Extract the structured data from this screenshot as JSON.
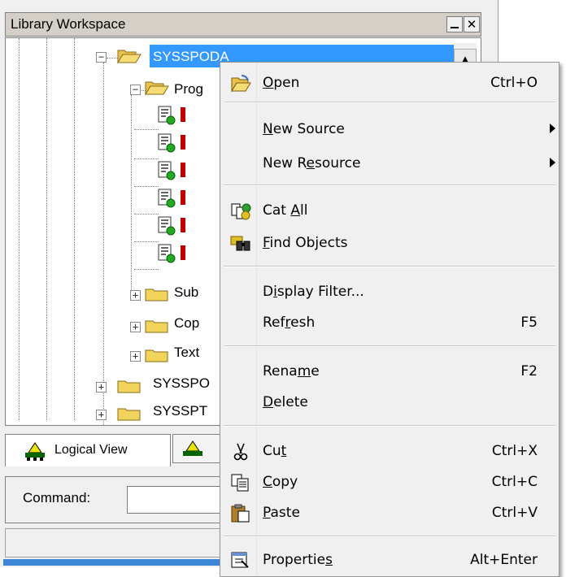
{
  "window": {
    "title": "Library Workspace"
  },
  "tree": {
    "selected_label": "SYSSPODA",
    "child_folder_label": "Prog",
    "subfolders": [
      "Sub",
      "Cop",
      "Text"
    ],
    "siblings": [
      "SYSSPO",
      "SYSSPT"
    ]
  },
  "tabs": {
    "logical_view": "Logical View"
  },
  "command": {
    "label": "Command:",
    "value": ""
  },
  "menu": {
    "open": {
      "label": "Open",
      "mnemonic_index": 0,
      "shortcut": "Ctrl+O",
      "icon": "open-folder-icon"
    },
    "new_source": {
      "label": "New Source",
      "mnemonic_index": 0,
      "has_submenu": true
    },
    "new_resource": {
      "label": "New Resource",
      "mnemonic_index": 5,
      "has_submenu": true
    },
    "cat_all": {
      "label": "Cat All",
      "mnemonic_index": 4,
      "icon": "cat-all-icon"
    },
    "find_objects": {
      "label": "Find Objects",
      "mnemonic_index": 0,
      "icon": "binoculars-icon"
    },
    "display_filter": {
      "label": "Display Filter...",
      "mnemonic_index": 1
    },
    "refresh": {
      "label": "Refresh",
      "mnemonic_index": 3,
      "shortcut": "F5"
    },
    "rename": {
      "label": "Rename",
      "mnemonic_index": 4,
      "shortcut": "F2"
    },
    "delete": {
      "label": "Delete",
      "mnemonic_index": 0
    },
    "cut": {
      "label": "Cut",
      "mnemonic_index": 2,
      "shortcut": "Ctrl+X",
      "icon": "scissors-icon"
    },
    "copy": {
      "label": "Copy",
      "mnemonic_index": 0,
      "shortcut": "Ctrl+C",
      "icon": "copy-icon"
    },
    "paste": {
      "label": "Paste",
      "mnemonic_index": 0,
      "shortcut": "Ctrl+V",
      "icon": "paste-icon"
    },
    "properties": {
      "label": "Properties",
      "mnemonic_index": 9,
      "shortcut": "Alt+Enter",
      "icon": "properties-icon"
    }
  },
  "colors": {
    "selection": "#3399ff",
    "folder": "#f2d45c",
    "menu_bg": "#f0f0f0",
    "accent_strip": "#3d87d6"
  }
}
